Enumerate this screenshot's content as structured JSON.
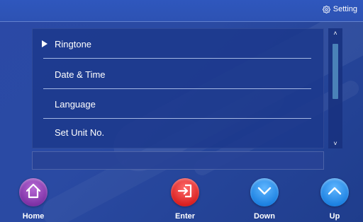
{
  "header": {
    "setting_label": "Setting",
    "setting_icon": "gear-icon"
  },
  "menu": {
    "items": [
      {
        "label": "Ringtone",
        "selected": true
      },
      {
        "label": "Date & Time",
        "selected": false
      },
      {
        "label": "Language",
        "selected": false
      },
      {
        "label": "Set Unit No.",
        "selected": false
      }
    ]
  },
  "scrollbar": {
    "up_glyph": "˄",
    "down_glyph": "˅"
  },
  "nav": {
    "home_label": "Home",
    "enter_label": "Enter",
    "down_label": "Down",
    "up_label": "Up"
  },
  "colors": {
    "background": "#2a4aa3",
    "home_button": "#7b2fa3",
    "enter_button": "#d81d1d",
    "down_button": "#1a7fe0",
    "up_button": "#1a7fe0"
  }
}
